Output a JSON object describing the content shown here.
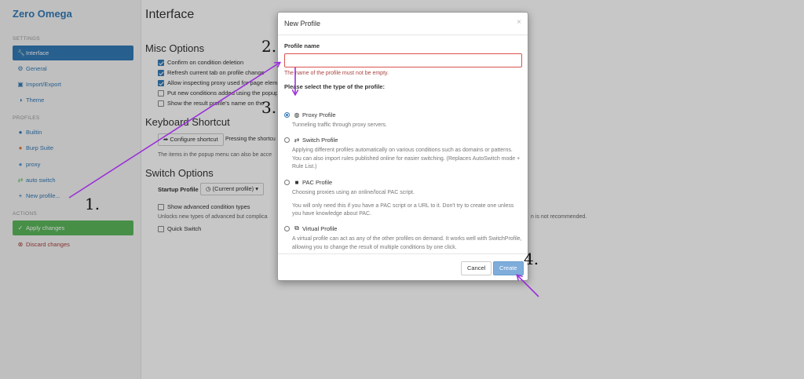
{
  "app": {
    "brand": "Zero Omega"
  },
  "sidebar": {
    "settings_header": "SETTINGS",
    "settings_items": [
      {
        "label": "Interface",
        "icon": "wrench-icon"
      },
      {
        "label": "General",
        "icon": "gear-icon"
      },
      {
        "label": "Import/Export",
        "icon": "floppy-icon"
      },
      {
        "label": "Theme",
        "icon": "contrast-icon"
      }
    ],
    "profiles_header": "PROFILES",
    "profile_items": [
      {
        "label": "Builtin",
        "icon": "globe-icon"
      },
      {
        "label": "Burp Suite",
        "icon": "globe-icon"
      },
      {
        "label": "proxy",
        "icon": "globe-icon"
      },
      {
        "label": "auto switch",
        "icon": "switch-icon"
      },
      {
        "label": "New profile...",
        "icon": "plus-icon"
      }
    ],
    "actions_header": "ACTIONS",
    "apply_label": "Apply changes",
    "discard_label": "Discard changes"
  },
  "main": {
    "title": "Interface",
    "misc_title": "Misc Options",
    "misc_options": [
      {
        "label": "Confirm on condition deletion",
        "checked": true
      },
      {
        "label": "Refresh current tab on profile change",
        "checked": true
      },
      {
        "label": "Allow inspecting proxy used for page eleme",
        "checked": true
      },
      {
        "label": "Put new conditions added using the popup",
        "checked": false
      },
      {
        "label": "Show the result profile's name on the",
        "checked": false
      }
    ],
    "keyboard_title": "Keyboard Shortcut",
    "configure_shortcut_label": "Configure shortcut",
    "pressing_text": "Pressing the shortcu",
    "popup_help": "The items in the popup menu can also be acce",
    "switch_title": "Switch Options",
    "startup_label": "Startup Profile",
    "startup_value": "(Current profile)",
    "advanced_label": "Show advanced condition types",
    "advanced_help_left": "Unlocks new types of advanced but complica",
    "advanced_help_right": "n is not recommended.",
    "quick_switch_label": "Quick Switch"
  },
  "modal": {
    "title": "New Profile",
    "close": "×",
    "name_label": "Profile name",
    "name_value": "",
    "name_error": "The name of the profile must not be empty.",
    "type_label": "Please select the type of the profile:",
    "options": [
      {
        "name": "Proxy Profile",
        "icon": "globe-icon",
        "selected": true,
        "desc": "Tunneling traffic through proxy servers."
      },
      {
        "name": "Switch Profile",
        "icon": "switch-icon",
        "selected": false,
        "desc": "Applying different profiles automatically on various conditions such as domains or patterns. You can also import rules published online for easier switching. (Replaces AutoSwitch mode + Rule List.)"
      },
      {
        "name": "PAC Profile",
        "icon": "file-icon",
        "selected": false,
        "desc": "Choosing proxies using an online/local PAC script.",
        "desc2": "You will only need this if you have a PAC script or a URL to it. Don't try to create one unless you have knowledge about PAC."
      },
      {
        "name": "Virtual Profile",
        "icon": "clone-icon",
        "selected": false,
        "desc": "A virtual profile can act as any of the other profiles on demand. It works well with SwitchProfile, allowing you to change the result of multiple conditions by one click."
      }
    ],
    "cancel_label": "Cancel",
    "create_label": "Create"
  },
  "annotations": {
    "labels": [
      "1.",
      "2.",
      "3.",
      "4."
    ],
    "color": "#9b30d9"
  }
}
